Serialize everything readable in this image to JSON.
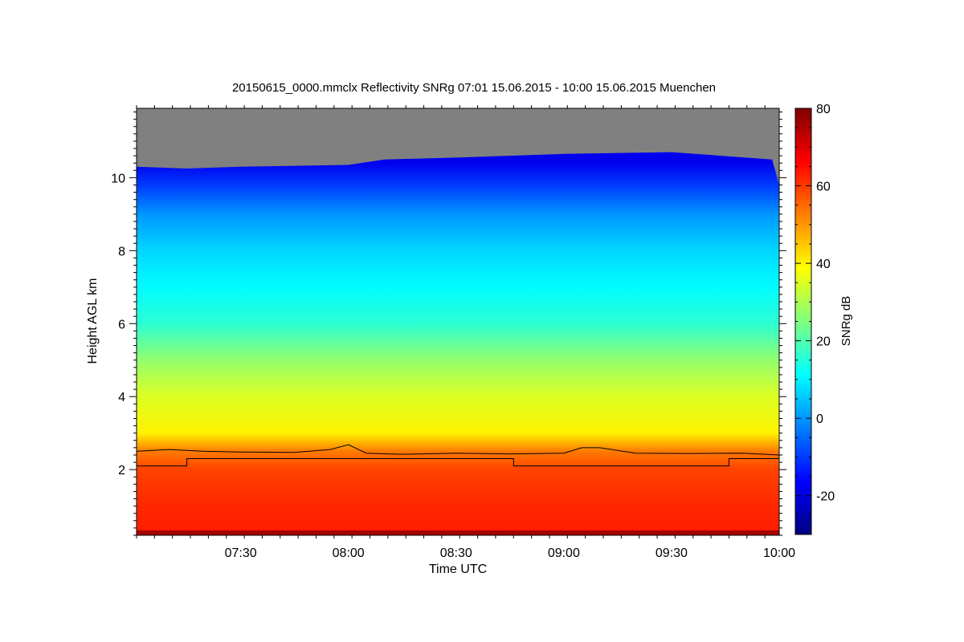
{
  "chart_data": {
    "type": "heatmap",
    "title": "20150615_0000.mmclx Reflectivity SNRg   07:01 15.06.2015 - 10:00 15.06.2015 Muenchen",
    "xlabel": "Time UTC",
    "ylabel": "Height AGL km",
    "x_range": [
      "07:01",
      "10:00"
    ],
    "x_ticks": [
      "07:30",
      "08:00",
      "08:30",
      "09:00",
      "09:30",
      "10:00"
    ],
    "ylim": [
      0.2,
      11.9
    ],
    "y_ticks": [
      2,
      4,
      6,
      8,
      10
    ],
    "colorbar": {
      "label": "SNRg dB",
      "range": [
        -30,
        80
      ],
      "ticks": [
        -20,
        0,
        20,
        40,
        60,
        80
      ],
      "colormap": [
        "#00007f",
        "#0000ff",
        "#007fff",
        "#00ffff",
        "#7fff7f",
        "#ffff00",
        "#ff7f00",
        "#ff0000",
        "#7f0000"
      ]
    },
    "no_data_color": "#808080",
    "profile": [
      {
        "height": 0.3,
        "snr": 63
      },
      {
        "height": 1.0,
        "snr": 62
      },
      {
        "height": 2.0,
        "snr": 59
      },
      {
        "height": 2.5,
        "snr": 53
      },
      {
        "height": 3.0,
        "snr": 40
      },
      {
        "height": 4.0,
        "snr": 35
      },
      {
        "height": 5.0,
        "snr": 27
      },
      {
        "height": 6.0,
        "snr": 16
      },
      {
        "height": 7.0,
        "snr": 11
      },
      {
        "height": 8.0,
        "snr": 7
      },
      {
        "height": 9.0,
        "snr": 0
      },
      {
        "height": 9.8,
        "snr": -10
      },
      {
        "height": 10.4,
        "snr": -18
      }
    ],
    "echo_top_km": [
      {
        "time": "07:01",
        "height": 10.3
      },
      {
        "time": "07:15",
        "height": 10.25
      },
      {
        "time": "07:30",
        "height": 10.3
      },
      {
        "time": "08:00",
        "height": 10.35
      },
      {
        "time": "08:10",
        "height": 10.5
      },
      {
        "time": "08:30",
        "height": 10.55
      },
      {
        "time": "09:00",
        "height": 10.65
      },
      {
        "time": "09:30",
        "height": 10.7
      },
      {
        "time": "09:58",
        "height": 10.5
      },
      {
        "time": "10:00",
        "height": 9.8
      }
    ],
    "series": [
      {
        "x": [
          "07:01",
          "07:10",
          "07:20",
          "07:30",
          "07:45",
          "07:55",
          "08:00",
          "08:05",
          "08:15",
          "08:30",
          "08:45",
          "09:00",
          "09:05",
          "09:10",
          "09:20",
          "09:35",
          "09:50",
          "10:00"
        ],
        "y": [
          2.5,
          2.55,
          2.5,
          2.48,
          2.47,
          2.55,
          2.68,
          2.45,
          2.42,
          2.45,
          2.43,
          2.45,
          2.6,
          2.6,
          2.45,
          2.44,
          2.45,
          2.4
        ]
      },
      {
        "x": [
          "07:01",
          "07:15",
          "07:15",
          "08:46",
          "08:46",
          "09:46",
          "09:46",
          "10:00"
        ],
        "y": [
          2.1,
          2.1,
          2.3,
          2.3,
          2.1,
          2.1,
          2.3,
          2.3
        ]
      }
    ]
  }
}
